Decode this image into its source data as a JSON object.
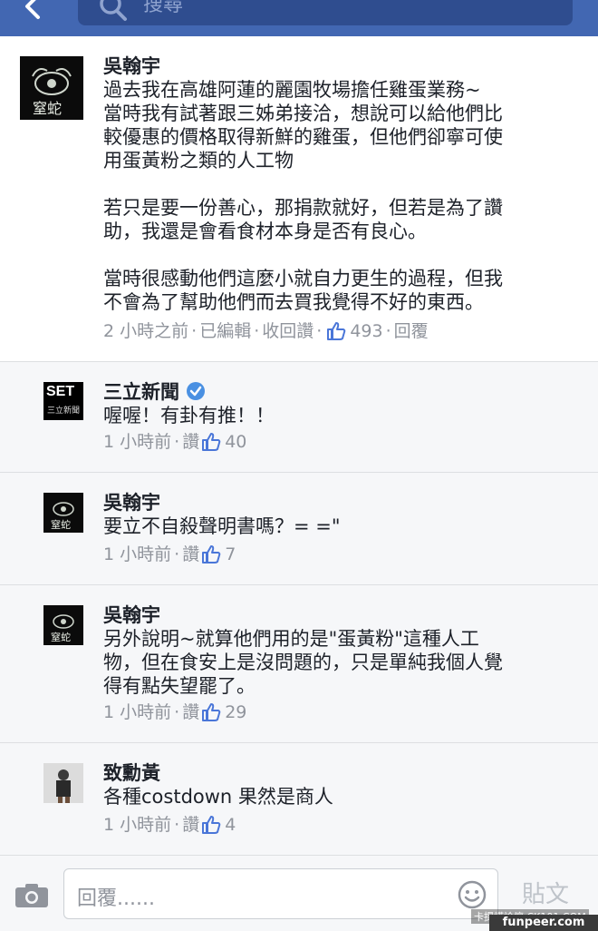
{
  "header": {
    "search_placeholder": "搜尋"
  },
  "post": {
    "author": "吳翰宇",
    "avatar_text": "窒蛇",
    "paragraphs": [
      "過去我在高雄阿蓮的麗園牧場擔任雞蛋業務~",
      "當時我有試著跟三姊弟接洽，想說可以給他們比",
      "較優惠的價格取得新鮮的雞蛋，但他們卻寧可使",
      "用蛋黃粉之類的人工物",
      "若只是要一份善心，那捐款就好，但若是為了讚",
      "助，我還是會看食材本身是否有良心。",
      "當時很感動他們這麼小就自力更生的過程，但我",
      "不會為了幫助他們而去買我覺得不好的東西。"
    ],
    "time": "2 小時之前",
    "edited": "已編輯",
    "unlike": "收回讚",
    "likes": "493",
    "reply": "回覆"
  },
  "comments": [
    {
      "author": "三立新聞",
      "avatar_text": "SET",
      "avatar_sub": "三立新聞",
      "verified": true,
      "lines": [
        "喔喔！有卦有推！！"
      ],
      "time": "1 小時前",
      "like": "讚",
      "likes": "40"
    },
    {
      "author": "吳翰宇",
      "avatar_text": "窒蛇",
      "lines": [
        "要立不自殺聲明書嗎？= =\""
      ],
      "time": "1 小時前",
      "like": "讚",
      "likes": "7"
    },
    {
      "author": "吳翰宇",
      "avatar_text": "窒蛇",
      "lines": [
        "另外說明~就算他們用的是\"蛋黃粉\"這種人工",
        "物，但在食安上是沒問題的，只是單純我個人覺",
        "得有點失望罷了。"
      ],
      "time": "1 小時前",
      "like": "讚",
      "likes": "29"
    },
    {
      "author": "致勳黃",
      "lines": [
        "各種costdown 果然是商人"
      ],
      "time": "1 小時前",
      "like": "讚",
      "likes": "4"
    }
  ],
  "composer": {
    "placeholder": "回覆......",
    "post_label": "貼文"
  },
  "watermark": {
    "small": "卡提諾論壇 CK101.COM",
    "site": "funpeer.com"
  },
  "colors": {
    "brand": "#4267b2",
    "like_blue": "#4a76d8",
    "meta_gray": "#90949c"
  }
}
